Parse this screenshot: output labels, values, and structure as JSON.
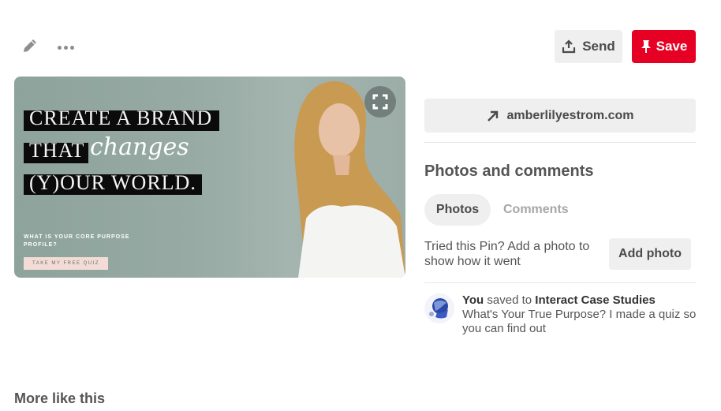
{
  "toolbar": {
    "edit_icon": "pencil-icon",
    "more_icon": "ellipsis-icon",
    "send_label": "Send",
    "send_icon": "share-upload-icon",
    "save_label": "Save",
    "save_icon": "pushpin-icon"
  },
  "pin_image": {
    "headline_lines": [
      "CREATE A BRAND",
      "THAT",
      "(Y)OUR WORLD."
    ],
    "script_word": "changes",
    "subtext": "WHAT IS YOUR CORE PURPOSE PROFILE?",
    "cta": "TAKE MY FREE QUIZ",
    "expand_icon": "expand-icon"
  },
  "source_link": {
    "label": "amberlilyestrom.com",
    "icon": "arrow-up-right-icon"
  },
  "photos_comments": {
    "title": "Photos and comments",
    "tabs": [
      {
        "label": "Photos",
        "active": true
      },
      {
        "label": "Comments",
        "active": false
      }
    ],
    "prompt": "Tried this Pin? Add a photo to show how it went",
    "add_photo_label": "Add photo"
  },
  "activity": {
    "user": "You",
    "action": "saved to",
    "board": "Interact Case Studies",
    "description": "What's Your True Purpose? I made a quiz so you can find out"
  },
  "more_like_this": "More like this",
  "colors": {
    "brand_red": "#e60023",
    "button_gray": "#efefef",
    "image_bg": "#97aaa4"
  }
}
